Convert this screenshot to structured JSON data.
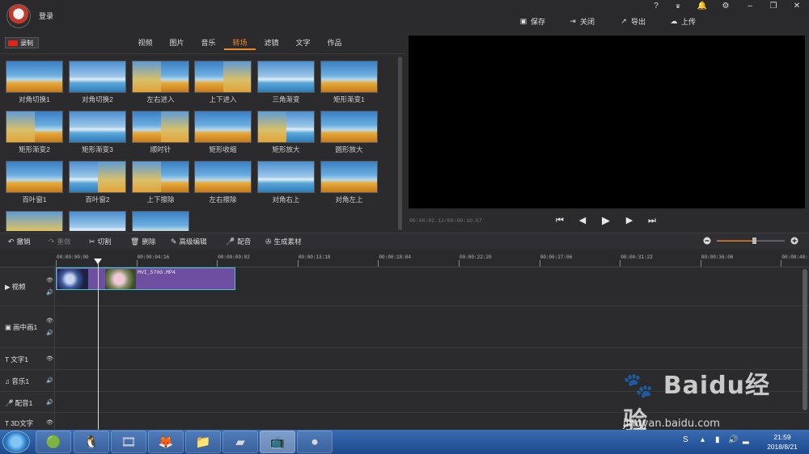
{
  "app": {
    "login": "登录",
    "window_controls": [
      "?",
      "VIP",
      "🔔",
      "⚙",
      "–",
      "❐",
      "✕"
    ],
    "toolbar": {
      "save": "保存",
      "close": "关闭",
      "export": "导出",
      "upload": "上传"
    }
  },
  "media": {
    "record": "录制",
    "tabs": [
      "视频",
      "图片",
      "音乐",
      "转场",
      "滤镜",
      "文字",
      "作品"
    ],
    "active_tab": "转场",
    "transitions": [
      {
        "label": "对角切换1"
      },
      {
        "label": "对角切换2"
      },
      {
        "label": "左右进入"
      },
      {
        "label": "上下进入"
      },
      {
        "label": "三角渐变"
      },
      {
        "label": "矩形渐变1"
      },
      {
        "label": "矩形渐变2"
      },
      {
        "label": "矩形渐变3"
      },
      {
        "label": "顺时针"
      },
      {
        "label": "矩形收缩"
      },
      {
        "label": "矩形放大"
      },
      {
        "label": "圆形放大"
      },
      {
        "label": "百叶窗1"
      },
      {
        "label": "百叶窗2"
      },
      {
        "label": "上下擦除"
      },
      {
        "label": "左右擦除"
      },
      {
        "label": "对角右上"
      },
      {
        "label": "对角左上"
      },
      {
        "label": ""
      },
      {
        "label": ""
      },
      {
        "label": ""
      }
    ]
  },
  "preview": {
    "time": "00:00:02.12/00:00:10.07"
  },
  "editbar": {
    "undo": "撤销",
    "redo": "重做",
    "cut": "切割",
    "delete": "删除",
    "advanced": "高级编辑",
    "dub": "配音",
    "generate": "生成素材"
  },
  "ruler": {
    "ticks": [
      "00:00:00:00",
      "00:00:04:16",
      "00:00:09:02",
      "00:00:13:18",
      "00:00:18:04",
      "00:00:22:20",
      "00:00:27:06",
      "00:00:31:22",
      "00:00:36:08",
      "00:00:40:"
    ]
  },
  "tracks": {
    "video": "视频",
    "pip": "画中画1",
    "text": "文字1",
    "music": "音乐1",
    "voice": "配音1",
    "text3d": "3D文字",
    "clip_name": "MVI_5700.MP4"
  },
  "taskbar": {
    "time": "21:59",
    "date": "2018/8/21"
  },
  "watermark": {
    "brand": "Baidu经验",
    "url": "jingyan.baidu.com"
  }
}
